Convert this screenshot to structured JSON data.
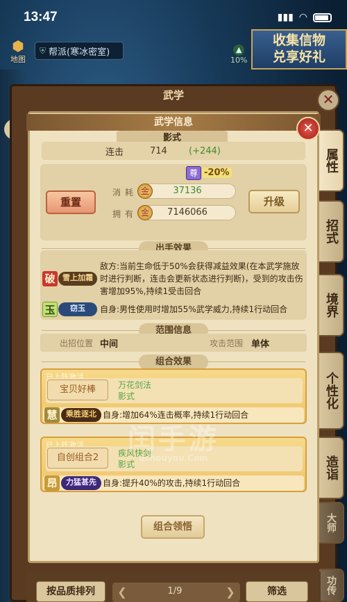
{
  "status_bar": {
    "time": "13:47"
  },
  "hud": {
    "map_label": "地图",
    "faction_label": "帮派(寒冰密室)",
    "boost_pct": "10%",
    "collect_banner_line1": "收集信物",
    "collect_banner_line2": "兑享好礼"
  },
  "window": {
    "title": "武学"
  },
  "side_tabs": [
    {
      "label": "属性"
    },
    {
      "label": "招式"
    },
    {
      "label": "境界"
    },
    {
      "label": "个性化"
    },
    {
      "label": "造诣"
    },
    {
      "label": "大师"
    },
    {
      "label": "功传"
    }
  ],
  "panel": {
    "title": "武学信息",
    "martial_name": "影式",
    "stat": {
      "name": "连击",
      "value": "714",
      "bonus": "(+244)"
    },
    "upgrade": {
      "reset_label": "重置",
      "upgrade_label": "升级",
      "vip_char": "尊",
      "discount": "-20%",
      "cost_label": "消耗",
      "cost_value": "37136",
      "own_label": "拥有",
      "own_value": "7146066",
      "coin_char": "金"
    },
    "effects_title": "出手效果",
    "effects": [
      {
        "badge": "破",
        "tag": "雪上加霜",
        "text": "敌方:当前生命低于50%会获得减益效果(在本武学施放时进行判断，连击会更新状态进行判断)，受到的攻击伤害增加95%,持续1受击回合"
      },
      {
        "badge": "玉",
        "tag": "窃玉",
        "text": "自身:男性使用时增加55%武学威力,持续1行动回合"
      }
    ],
    "range_title": "范围信息",
    "range": {
      "position_label": "出招位置",
      "position_value": "中间",
      "attack_label": "攻击范围",
      "attack_value": "单体"
    },
    "combo_title": "组合效果",
    "combos": [
      {
        "status": "已上阵激活",
        "name": "宝贝好棒",
        "members": [
          "万花剑法",
          "影式"
        ],
        "badge": "慧",
        "tag": "乘胜逐北",
        "effect": "自身:增加64%连击概率,持续1行动回合"
      },
      {
        "status": "已上阵激活",
        "name": "自创组合2",
        "members": [
          "疾风快剑",
          "影式"
        ],
        "badge": "昂",
        "tag": "力猛甚先",
        "effect": "自身:提升40%的攻击,持续1行动回合"
      }
    ],
    "combo_button": "组合领悟"
  },
  "bottom": {
    "sort_label": "按品质排列",
    "page": "1/9",
    "filter_label": "筛选"
  },
  "watermark": {
    "big": "闰手游",
    "small": "ashouyou.Com"
  },
  "colors": {
    "panel_bg": "#efe2c1",
    "combo_gold": "#eec46a",
    "reset_red": "#e89673",
    "bonus_green": "#3f8b32"
  }
}
